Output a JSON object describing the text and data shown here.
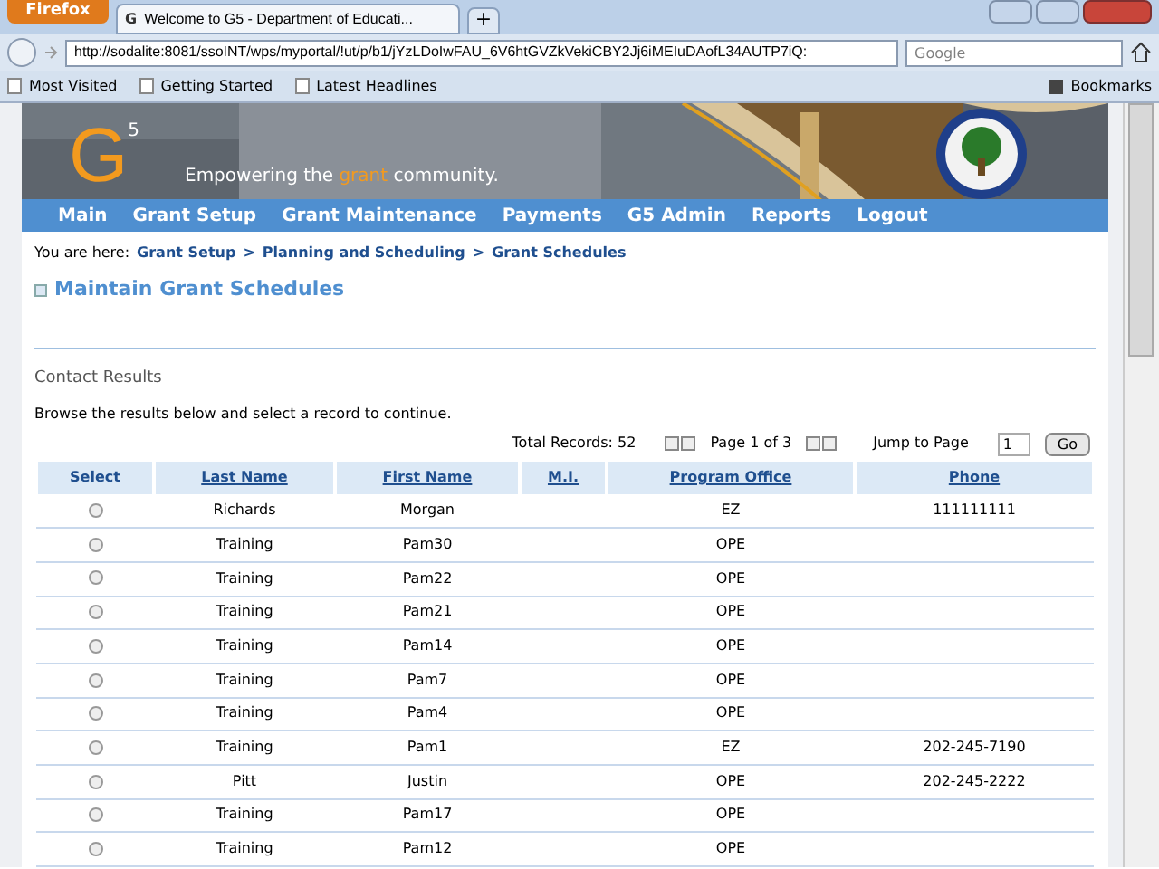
{
  "browser": {
    "menu_button": "Firefox",
    "site_icon": "G",
    "tab_title": "Welcome to G5 - Department of Educati...",
    "new_tab": "+",
    "url": "http://sodalite:8081/ssoINT/wps/myportal/!ut/p/b1/jYzLDoIwFAU_6V6htGVZkVekiCBY2Jj6iMEIuDAofL34AUTP7iQ:",
    "search_placeholder": "Google",
    "bookmarks": [
      "Most Visited",
      "Getting Started",
      "Latest Headlines"
    ],
    "bookmarks_menu": "Bookmarks"
  },
  "banner": {
    "logo": "G",
    "logo_sup": "5",
    "tagline_before": "Empowering the",
    "tagline_highlight": "grant",
    "tagline_after": "community."
  },
  "nav": [
    "Main",
    "Grant Setup",
    "Grant Maintenance",
    "Payments",
    "G5 Admin",
    "Reports",
    "Logout"
  ],
  "breadcrumb": {
    "label": "You are here:",
    "items": [
      "Grant Setup",
      "Planning and Scheduling",
      "Grant Schedules"
    ],
    "separators": [
      ">",
      ">"
    ]
  },
  "page_title": "Maintain Grant Schedules",
  "section_title": "Contact Results",
  "instructions": "Browse the results below and select a record to continue.",
  "pager": {
    "total": "Total Records: 52",
    "page": "Page 1 of 3",
    "jump_label": "Jump to Page",
    "jump_value": "1",
    "go": "Go"
  },
  "table": {
    "columns": [
      "Select",
      "Last Name",
      "First Name",
      "M.I.",
      "Program Office",
      "Phone"
    ],
    "rows": [
      {
        "selected": false,
        "last": "Richards",
        "first": "Morgan",
        "mi": "",
        "office": "EZ",
        "phone": "111111111"
      },
      {
        "selected": false,
        "last": "Training",
        "first": "Pam30",
        "mi": "",
        "office": "OPE",
        "phone": ""
      },
      {
        "selected": false,
        "last": "Training",
        "first": "Pam22",
        "mi": "",
        "office": "OPE",
        "phone": ""
      },
      {
        "selected": false,
        "last": "Training",
        "first": "Pam21",
        "mi": "",
        "office": "OPE",
        "phone": ""
      },
      {
        "selected": false,
        "last": "Training",
        "first": "Pam14",
        "mi": "",
        "office": "OPE",
        "phone": ""
      },
      {
        "selected": false,
        "last": "Training",
        "first": "Pam7",
        "mi": "",
        "office": "OPE",
        "phone": ""
      },
      {
        "selected": false,
        "last": "Training",
        "first": "Pam4",
        "mi": "",
        "office": "OPE",
        "phone": ""
      },
      {
        "selected": false,
        "last": "Training",
        "first": "Pam1",
        "mi": "",
        "office": "EZ",
        "phone": "202-245-7190"
      },
      {
        "selected": false,
        "last": "Pitt",
        "first": "Justin",
        "mi": "",
        "office": "OPE",
        "phone": "202-245-2222"
      },
      {
        "selected": false,
        "last": "Training",
        "first": "Pam17",
        "mi": "",
        "office": "OPE",
        "phone": ""
      },
      {
        "selected": false,
        "last": "Training",
        "first": "Pam12",
        "mi": "",
        "office": "OPE",
        "phone": ""
      }
    ]
  }
}
